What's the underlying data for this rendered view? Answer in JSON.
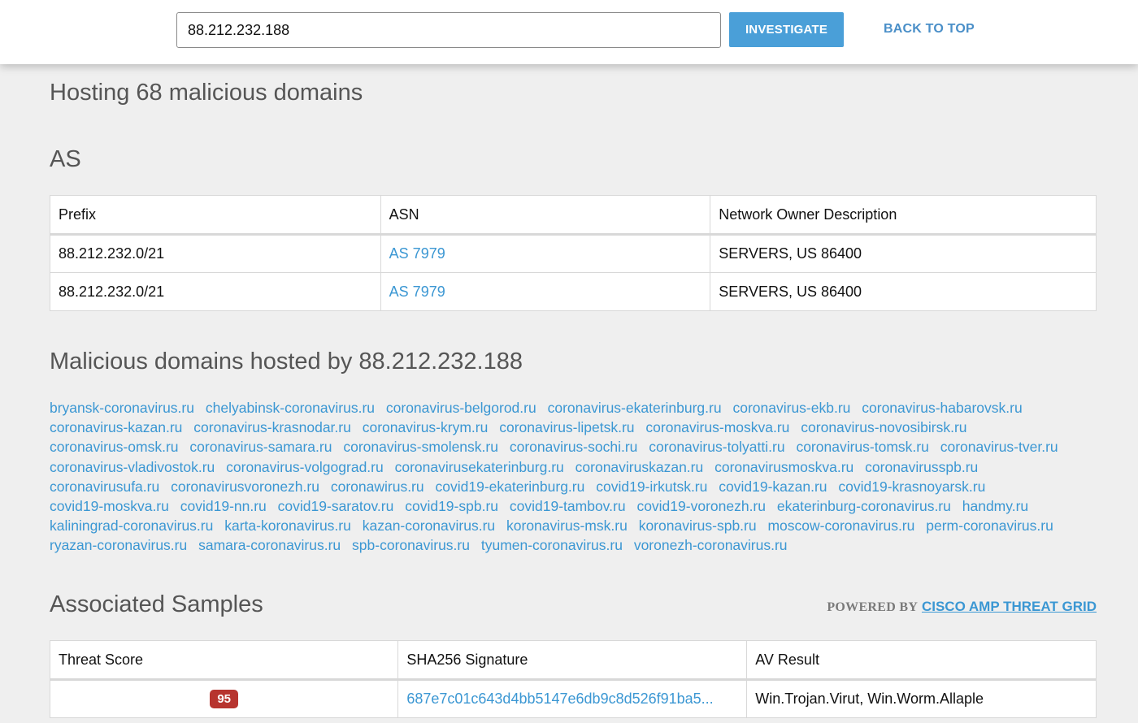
{
  "search": {
    "value": "88.212.232.188",
    "button_label": "INVESTIGATE",
    "back_to_top": "BACK TO TOP"
  },
  "hosting_title": "Hosting 68 malicious domains",
  "as_section": {
    "title": "AS",
    "headers": [
      "Prefix",
      "ASN",
      "Network Owner Description"
    ],
    "rows": [
      {
        "prefix": "88.212.232.0/21",
        "asn": "AS 7979",
        "owner": "SERVERS, US 86400"
      },
      {
        "prefix": "88.212.232.0/21",
        "asn": "AS 7979",
        "owner": "SERVERS, US 86400"
      }
    ]
  },
  "domains_section": {
    "title": "Malicious domains hosted by 88.212.232.188",
    "domains": [
      "bryansk-coronavirus.ru",
      "chelyabinsk-coronavirus.ru",
      "coronavirus-belgorod.ru",
      "coronavirus-ekaterinburg.ru",
      "coronavirus-ekb.ru",
      "coronavirus-habarovsk.ru",
      "coronavirus-kazan.ru",
      "coronavirus-krasnodar.ru",
      "coronavirus-krym.ru",
      "coronavirus-lipetsk.ru",
      "coronavirus-moskva.ru",
      "coronavirus-novosibirsk.ru",
      "coronavirus-omsk.ru",
      "coronavirus-samara.ru",
      "coronavirus-smolensk.ru",
      "coronavirus-sochi.ru",
      "coronavirus-tolyatti.ru",
      "coronavirus-tomsk.ru",
      "coronavirus-tver.ru",
      "coronavirus-vladivostok.ru",
      "coronavirus-volgograd.ru",
      "coronavirusekaterinburg.ru",
      "coronaviruskazan.ru",
      "coronavirusmoskva.ru",
      "coronavirusspb.ru",
      "coronavirusufa.ru",
      "coronavirusvoronezh.ru",
      "coronawirus.ru",
      "covid19-ekaterinburg.ru",
      "covid19-irkutsk.ru",
      "covid19-kazan.ru",
      "covid19-krasnoyarsk.ru",
      "covid19-moskva.ru",
      "covid19-nn.ru",
      "covid19-saratov.ru",
      "covid19-spb.ru",
      "covid19-tambov.ru",
      "covid19-voronezh.ru",
      "ekaterinburg-coronavirus.ru",
      "handmy.ru",
      "kaliningrad-coronavirus.ru",
      "karta-koronavirus.ru",
      "kazan-coronavirus.ru",
      "koronavirus-msk.ru",
      "koronavirus-spb.ru",
      "moscow-coronavirus.ru",
      "perm-coronavirus.ru",
      "ryazan-coronavirus.ru",
      "samara-coronavirus.ru",
      "spb-coronavirus.ru",
      "tyumen-coronavirus.ru",
      "voronezh-coronavirus.ru"
    ]
  },
  "samples_section": {
    "title": "Associated Samples",
    "powered_prefix": "POWERED BY",
    "powered_brand": "CISCO AMP THREAT GRID",
    "headers": [
      "Threat Score",
      "SHA256 Signature",
      "AV Result"
    ],
    "rows": [
      {
        "score": "95",
        "sha": "687e7c01c643d4bb5147e6db9c8d526f91ba5...",
        "av": "Win.Trojan.Virut, Win.Worm.Allaple"
      }
    ]
  },
  "colors": {
    "accent": "#4a9fd8",
    "link": "#3b97d3",
    "badge": "#b7342f",
    "background": "#efefef"
  }
}
